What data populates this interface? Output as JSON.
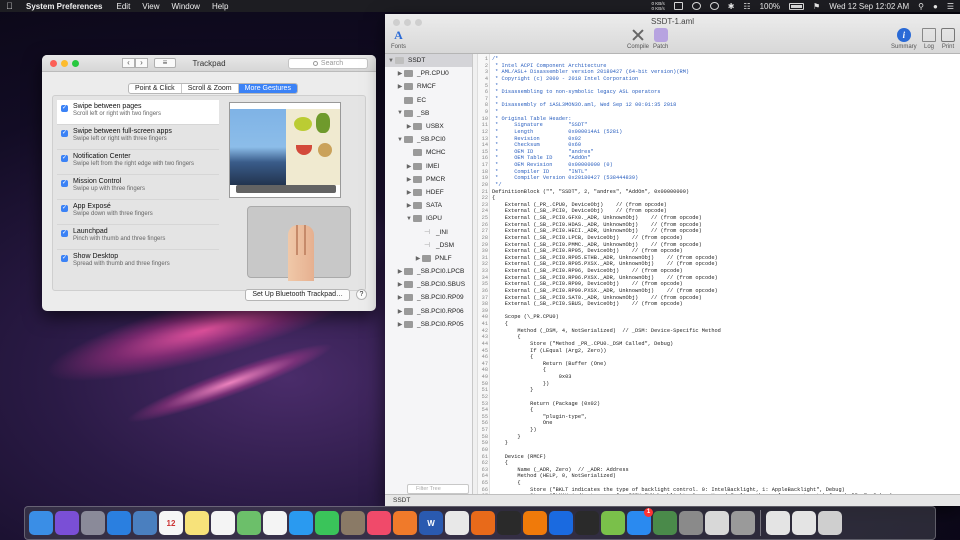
{
  "menubar": {
    "app_name": "System Preferences",
    "menus": [
      "Edit",
      "View",
      "Window",
      "Help"
    ],
    "net_up": "0 KB/s",
    "net_down": "0 KB/s",
    "battery": "100%",
    "datetime": "Wed 12 Sep  12:02 AM"
  },
  "trackpad": {
    "title": "Trackpad",
    "search_placeholder": "Search",
    "tabs": [
      "Point & Click",
      "Scroll & Zoom",
      "More Gestures"
    ],
    "active_tab": "More Gestures",
    "gestures": [
      {
        "title": "Swipe between pages",
        "sub": "Scroll left or right with two fingers"
      },
      {
        "title": "Swipe between full-screen apps",
        "sub": "Swipe left or right with three fingers"
      },
      {
        "title": "Notification Center",
        "sub": "Swipe left from the right edge with two fingers"
      },
      {
        "title": "Mission Control",
        "sub": "Swipe up with three fingers"
      },
      {
        "title": "App Exposé",
        "sub": "Swipe down with three fingers"
      },
      {
        "title": "Launchpad",
        "sub": "Pinch with thumb and three fingers"
      },
      {
        "title": "Show Desktop",
        "sub": "Spread with thumb and three fingers"
      }
    ],
    "bluetooth_button": "Set Up Bluetooth Trackpad…",
    "help": "?"
  },
  "ssdt": {
    "title": "SSDT-1.aml",
    "toolbar": {
      "fonts": "Fonts",
      "compile": "Compile",
      "patch": "Patch",
      "summary": "Summary",
      "log": "Log",
      "print": "Print"
    },
    "tree": [
      {
        "label": "SSDT",
        "level": 0,
        "arrow": "▼",
        "icon": "light",
        "selected": true
      },
      {
        "label": "_PR.CPU0",
        "level": 1,
        "arrow": "▶",
        "icon": "box"
      },
      {
        "label": "RMCF",
        "level": 1,
        "arrow": "▶",
        "icon": "box"
      },
      {
        "label": "EC",
        "level": 1,
        "arrow": "",
        "icon": "box"
      },
      {
        "label": "_SB",
        "level": 1,
        "arrow": "▼",
        "icon": "box"
      },
      {
        "label": "USBX",
        "level": 2,
        "arrow": "▶",
        "icon": "box"
      },
      {
        "label": "_SB.PCI0",
        "level": 1,
        "arrow": "▼",
        "icon": "box"
      },
      {
        "label": "MCHC",
        "level": 2,
        "arrow": "",
        "icon": "box"
      },
      {
        "label": "IMEI",
        "level": 2,
        "arrow": "▶",
        "icon": "box"
      },
      {
        "label": "PMCR",
        "level": 2,
        "arrow": "▶",
        "icon": "box"
      },
      {
        "label": "HDEF",
        "level": 2,
        "arrow": "▶",
        "icon": "box"
      },
      {
        "label": "SATA",
        "level": 2,
        "arrow": "▶",
        "icon": "box"
      },
      {
        "label": "IGPU",
        "level": 2,
        "arrow": "▼",
        "icon": "box"
      },
      {
        "label": "_INI",
        "level": 3,
        "arrow": "",
        "icon": "obj"
      },
      {
        "label": "_DSM",
        "level": 3,
        "arrow": "",
        "icon": "obj"
      },
      {
        "label": "PNLF",
        "level": 3,
        "arrow": "▶",
        "icon": "box"
      },
      {
        "label": "_SB.PCI0.LPCB",
        "level": 1,
        "arrow": "▶",
        "icon": "box"
      },
      {
        "label": "_SB.PCI0.SBUS",
        "level": 1,
        "arrow": "▶",
        "icon": "box"
      },
      {
        "label": "_SB.PCI0.RP09",
        "level": 1,
        "arrow": "▶",
        "icon": "box"
      },
      {
        "label": "_SB.PCI0.RP06",
        "level": 1,
        "arrow": "▶",
        "icon": "box"
      },
      {
        "label": "_SB.PCI0.RP05",
        "level": 1,
        "arrow": "▶",
        "icon": "box"
      }
    ],
    "filter_placeholder": "Filter Tree",
    "status": "SSDT",
    "code": [
      "/*",
      " * Intel ACPI Component Architecture",
      " * AML/ASL+ Disassembler version 20180427 (64-bit version)(RM)",
      " * Copyright (c) 2000 - 2018 Intel Corporation",
      " *",
      " * Disassembling to non-symbolic legacy ASL operators",
      " *",
      " * Disassembly of iASL3MON3O.aml, Wed Sep 12 00:01:35 2018",
      " *",
      " * Original Table Header:",
      " *     Signature        \"SSDT\"",
      " *     Length           0x000014A1 (5281)",
      " *     Revision         0x02",
      " *     Checksum         0x60",
      " *     OEM ID           \"andres\"",
      " *     OEM Table ID     \"AddOn\"",
      " *     OEM Revision     0x00000000 (0)",
      " *     Compiler ID      \"INTL\"",
      " *     Compiler Version 0x20180427 (538444839)",
      " */",
      "DefinitionBlock (\"\", \"SSDT\", 2, \"andres\", \"AddOn\", 0x00000000)",
      "{",
      "    External (_PR_.CPU0, DeviceObj)    // (from opcode)",
      "    External (_SB_.PCI0, DeviceObj)    // (from opcode)",
      "    External (_SB_.PCI0.GFX0._ADR, UnknownObj)    // (from opcode)",
      "    External (_SB_.PCI0.HDAS._ADR, UnknownObj)    // (from opcode)",
      "    External (_SB_.PCI0.HECI._ADR, UnknownObj)    // (from opcode)",
      "    External (_SB_.PCI0.LPCB, DeviceObj)    // (from opcode)",
      "    External (_SB_.PCI0.PMMC._ADR, UnknownObj)    // (from opcode)",
      "    External (_SB_.PCI0.RP05, DeviceObj)    // (from opcode)",
      "    External (_SB_.PCI0.RP05.ETHB._ADR, UnknownObj)    // (from opcode)",
      "    External (_SB_.PCI0.RP05.PXSX._ADR, UnknownObj)    // (from opcode)",
      "    External (_SB_.PCI0.RP06, DeviceObj)    // (from opcode)",
      "    External (_SB_.PCI0.RP06.PXSX._ADR, UnknownObj)    // (from opcode)",
      "    External (_SB_.PCI0.RP09, DeviceObj)    // (from opcode)",
      "    External (_SB_.PCI0.RP09.PXSX._ADR, UnknownObj)    // (from opcode)",
      "    External (_SB_.PCI0.SAT0._ADR, UnknownObj)    // (from opcode)",
      "    External (_SB_.PCI0.SBUS, DeviceObj)    // (from opcode)",
      "",
      "    Scope (\\_PR.CPU0)",
      "    {",
      "        Method (_DSM, 4, NotSerialized)  // _DSM: Device-Specific Method",
      "        {",
      "            Store (\"Method _PR_.CPU0._DSM Called\", Debug)",
      "            If (LEqual (Arg2, Zero))",
      "            {",
      "                Return (Buffer (One)",
      "                {",
      "                     0x03",
      "                })",
      "            }",
      "",
      "            Return (Package (0x02)",
      "            {",
      "                \"plugin-type\",",
      "                One",
      "            })",
      "        }",
      "    }",
      "",
      "    Device (RMCF)",
      "    {",
      "        Name (_ADR, Zero)  // _ADR: Address",
      "        Method (HELP, 0, NotSerialized)",
      "        {",
      "            Store (\"BKLT indicates the type of backlight control. 0: IntelBacklight, 1: AppleBacklight\", Debug)",
      "            Store (\"LMAX indicates max for IGPU PWM backlight. Ones: Use default, other values must match framebuffer\", Debug)",
      "        }"
    ]
  },
  "dock": {
    "apps": [
      {
        "name": "finder",
        "color": "#3a8ee6",
        "glyph": ""
      },
      {
        "name": "siri",
        "color": "#7a4fd6",
        "glyph": ""
      },
      {
        "name": "launchpad",
        "color": "#8a8a99",
        "glyph": ""
      },
      {
        "name": "safari",
        "color": "#2a7fe0",
        "glyph": ""
      },
      {
        "name": "preview",
        "color": "#4a7fbf",
        "glyph": ""
      },
      {
        "name": "calendar",
        "color": "#f6f6f6",
        "glyph": "12"
      },
      {
        "name": "notes",
        "color": "#f7e27a",
        "glyph": ""
      },
      {
        "name": "reminders",
        "color": "#f4f4f4",
        "glyph": ""
      },
      {
        "name": "maps",
        "color": "#6cbf6a",
        "glyph": ""
      },
      {
        "name": "photos",
        "color": "#f4f4f4",
        "glyph": ""
      },
      {
        "name": "messages-bubbles",
        "color": "#2a9af0",
        "glyph": ""
      },
      {
        "name": "facetime",
        "color": "#3ac45a",
        "glyph": ""
      },
      {
        "name": "contacts",
        "color": "#8a7a66",
        "glyph": ""
      },
      {
        "name": "music",
        "color": "#f04a6a",
        "glyph": ""
      },
      {
        "name": "books",
        "color": "#f07a2a",
        "glyph": ""
      },
      {
        "name": "word",
        "color": "#2a5ab0",
        "glyph": "W"
      },
      {
        "name": "chrome",
        "color": "#e8e8e8",
        "glyph": ""
      },
      {
        "name": "firefox",
        "color": "#e86a1a",
        "glyph": ""
      },
      {
        "name": "quicktime",
        "color": "#2a2a2a",
        "glyph": ""
      },
      {
        "name": "vlc",
        "color": "#f07a0a",
        "glyph": ""
      },
      {
        "name": "teamviewer",
        "color": "#1a6ae0",
        "glyph": ""
      },
      {
        "name": "terminal",
        "color": "#2a2a2a",
        "glyph": ""
      },
      {
        "name": "android",
        "color": "#7ac04a",
        "glyph": ""
      },
      {
        "name": "app-store",
        "color": "#2a8af0",
        "glyph": "",
        "badge": "1"
      },
      {
        "name": "xcode-helper",
        "color": "#4a8a4a",
        "glyph": ""
      },
      {
        "name": "system-preferences",
        "color": "#8a8a8a",
        "glyph": ""
      },
      {
        "name": "activity-monitor",
        "color": "#d8d8d8",
        "glyph": ""
      },
      {
        "name": "maciasl",
        "color": "#9a9a9a",
        "glyph": ""
      },
      {
        "name": "downloads",
        "color": "#e4e4e4",
        "glyph": ""
      },
      {
        "name": "documents",
        "color": "#e4e4e4",
        "glyph": ""
      },
      {
        "name": "trash",
        "color": "#cfcfcf",
        "glyph": ""
      }
    ]
  }
}
